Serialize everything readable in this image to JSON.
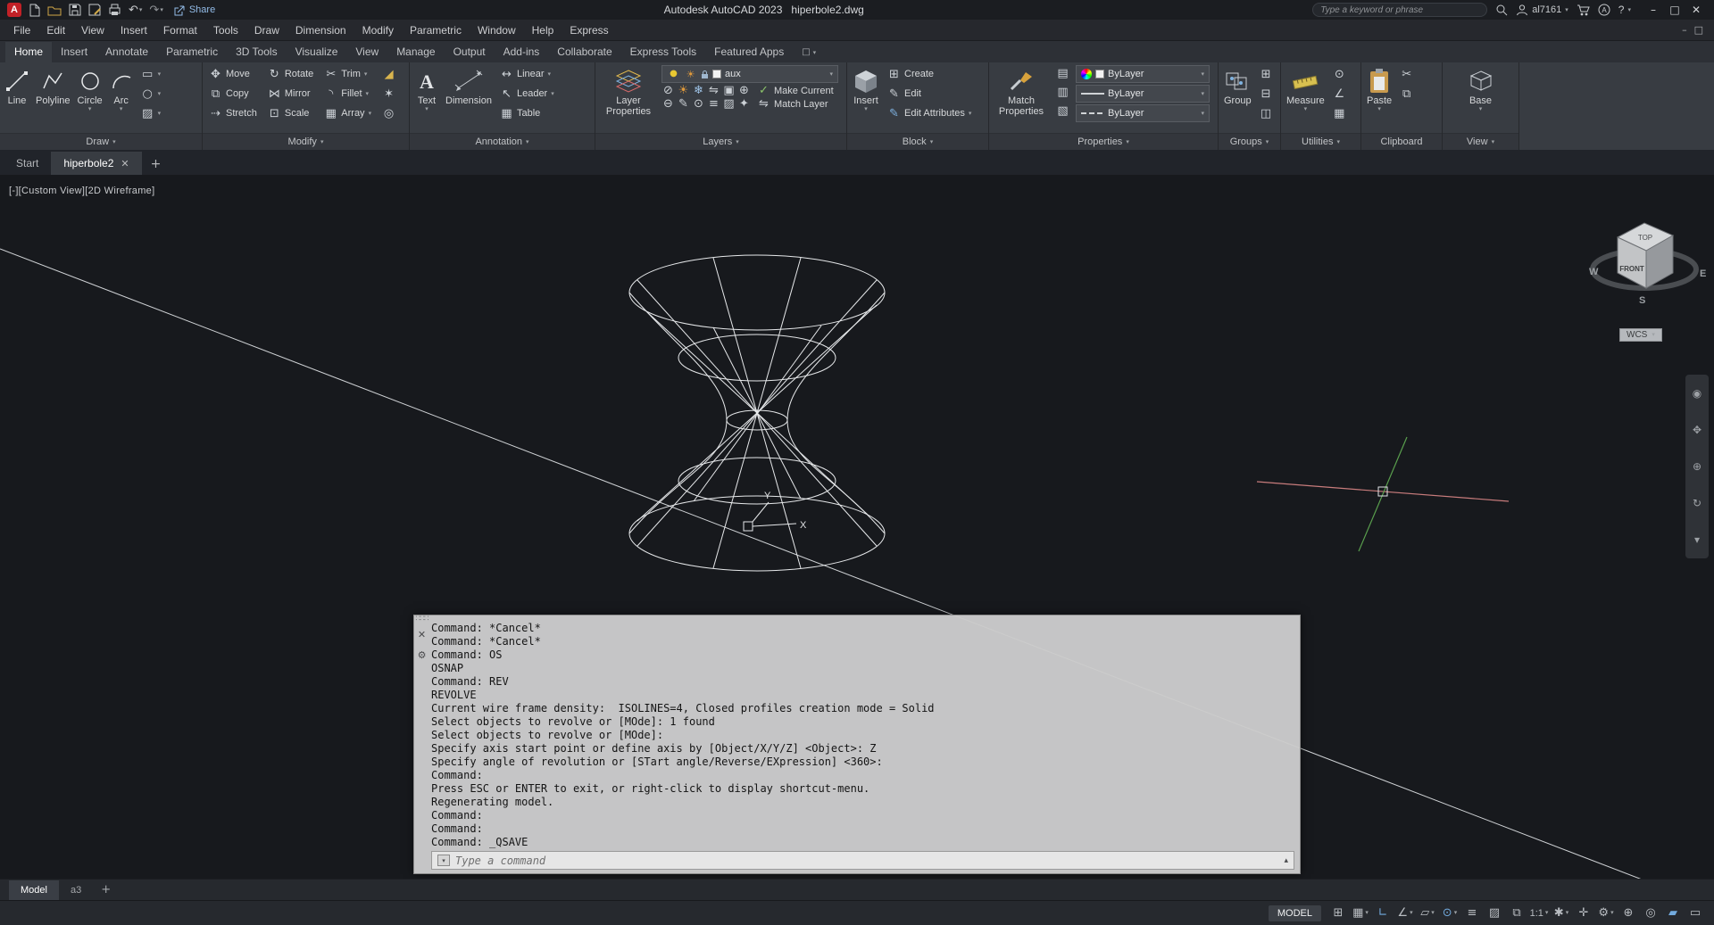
{
  "title_bar": {
    "share_label": "Share",
    "app_title": "Autodesk AutoCAD 2023   hiperbole2.dwg",
    "search_placeholder": "Type a keyword or phrase",
    "user_name": "al7161",
    "help_label": "?"
  },
  "menu_bar": {
    "items": [
      "File",
      "Edit",
      "View",
      "Insert",
      "Format",
      "Tools",
      "Draw",
      "Dimension",
      "Modify",
      "Parametric",
      "Window",
      "Help",
      "Express"
    ]
  },
  "ribbon_tabs": {
    "active": "Home",
    "items": [
      "Home",
      "Insert",
      "Annotate",
      "Parametric",
      "3D Tools",
      "Visualize",
      "View",
      "Manage",
      "Output",
      "Add-ins",
      "Collaborate",
      "Express Tools",
      "Featured Apps"
    ]
  },
  "ribbon": {
    "draw": {
      "label": "Draw",
      "line": "Line",
      "polyline": "Polyline",
      "circle": "Circle",
      "arc": "Arc"
    },
    "modify": {
      "label": "Modify",
      "move": "Move",
      "rotate": "Rotate",
      "trim": "Trim",
      "copy": "Copy",
      "mirror": "Mirror",
      "fillet": "Fillet",
      "stretch": "Stretch",
      "scale": "Scale",
      "array": "Array"
    },
    "annotation": {
      "label": "Annotation",
      "text": "Text",
      "dimension": "Dimension",
      "linear": "Linear",
      "leader": "Leader",
      "table": "Table"
    },
    "layers": {
      "label": "Layers",
      "layer_properties": "Layer Properties",
      "current_layer": "aux",
      "make_current": "Make Current",
      "match_layer": "Match Layer"
    },
    "block": {
      "label": "Block",
      "insert": "Insert",
      "create": "Create",
      "edit": "Edit",
      "edit_attributes": "Edit Attributes"
    },
    "properties": {
      "label": "Properties",
      "match_properties": "Match Properties",
      "color_value": "ByLayer",
      "lineweight_value": "ByLayer",
      "linetype_value": "ByLayer"
    },
    "groups": {
      "label": "Groups",
      "group": "Group"
    },
    "utilities": {
      "label": "Utilities",
      "measure": "Measure"
    },
    "clipboard": {
      "label": "Clipboard",
      "paste": "Paste"
    },
    "view": {
      "label": "View",
      "base": "Base"
    }
  },
  "file_tabs": {
    "start": "Start",
    "document": "hiperbole2"
  },
  "viewport": {
    "view_controls": "[-][Custom View][2D Wireframe]",
    "viewcube": {
      "top": "TOP",
      "front": "FRONT",
      "west": "W",
      "south": "S",
      "east": "E"
    },
    "wcs_label": "WCS",
    "ucs_x": "X",
    "ucs_y": "Y"
  },
  "command_window": {
    "lines": [
      "Command: *Cancel*",
      "Command: *Cancel*",
      "Command: OS",
      "OSNAP",
      "Command: REV",
      "REVOLVE",
      "Current wire frame density:  ISOLINES=4, Closed profiles creation mode = Solid",
      "Select objects to revolve or [MOde]: 1 found",
      "Select objects to revolve or [MOde]:",
      "Specify axis start point or define axis by [Object/X/Y/Z] <Object>: Z",
      "Specify angle of revolution or [STart angle/Reverse/EXpression] <360>:",
      "Command:",
      "Press ESC or ENTER to exit, or right-click to display shortcut-menu.",
      "Regenerating model.",
      "Command:",
      "Command:",
      "Command: _QSAVE"
    ],
    "input_placeholder": "Type a command"
  },
  "layout_tabs": {
    "model": "Model",
    "a3": "a3"
  },
  "status_bar": {
    "model_label": "MODEL",
    "annotation_scale": "1:1"
  },
  "icons": {
    "chevron_down": "▾",
    "chevron_up": "▴",
    "close": "✕",
    "minimize": "–",
    "maximize": "□",
    "undo": "↶",
    "redo": "↷",
    "move": "✥",
    "rotate": "↻",
    "trim": "✂",
    "copy": "⧉",
    "mirror": "⋈",
    "fillet": "◝",
    "stretch": "⇢",
    "scale": "⊡",
    "array": "▦",
    "erase": "◢",
    "explode": "✶",
    "offset": "◎",
    "rectangle": "▭",
    "ellipse": "○",
    "hatch": "▨",
    "linear": "↔",
    "leader": "↖",
    "table": "▦",
    "make_current": "✓",
    "match_layer": "⇋",
    "create": "⊞",
    "edit": "✎",
    "edit_attributes": "✎",
    "bulb": "●",
    "sun": "☀",
    "swatch": "□",
    "layer_tools": [
      "⊘",
      "☀",
      "❄",
      "⇋",
      "▣",
      "⊕",
      "⊖",
      "✎",
      "⊙",
      "≡",
      "▨",
      "✦"
    ],
    "prop_rows": [
      "▤",
      "▥",
      "▧"
    ],
    "group_tools": [
      "⊞",
      "⊟",
      "◫"
    ],
    "utility_tools": [
      "⊙",
      "∠",
      "▦"
    ],
    "clipboard_tools": [
      "✂",
      "⧉"
    ],
    "grid": "⊞",
    "snap": "▦",
    "ortho": "∟",
    "polar": "∠",
    "isodraft": "▱",
    "osnap": "⊙",
    "lineweight": "≡",
    "transparency": "▨",
    "selection_cycling": "⧉",
    "annotation_vis": "✱",
    "autoscale": "✛",
    "workspace": "⚙",
    "annotation_monitor": "⊕",
    "isolate": "◎",
    "graphics": "▰",
    "clean_screen": "▭",
    "grip": "∷∷∷",
    "wrench": "⚙",
    "prompt_box": "▾",
    "navbar": [
      "◉",
      "✥",
      "⊕",
      "↻",
      "▾"
    ]
  },
  "colors": {
    "ribbon_bg": "#383c42",
    "canvas_bg": "#17191d",
    "command_bg": "#cbcbcb",
    "accent_blue": "#72aade",
    "crosshair_red": "#c87c7c",
    "crosshair_green": "#5aa04e",
    "wireframe": "#e6e8ea"
  }
}
